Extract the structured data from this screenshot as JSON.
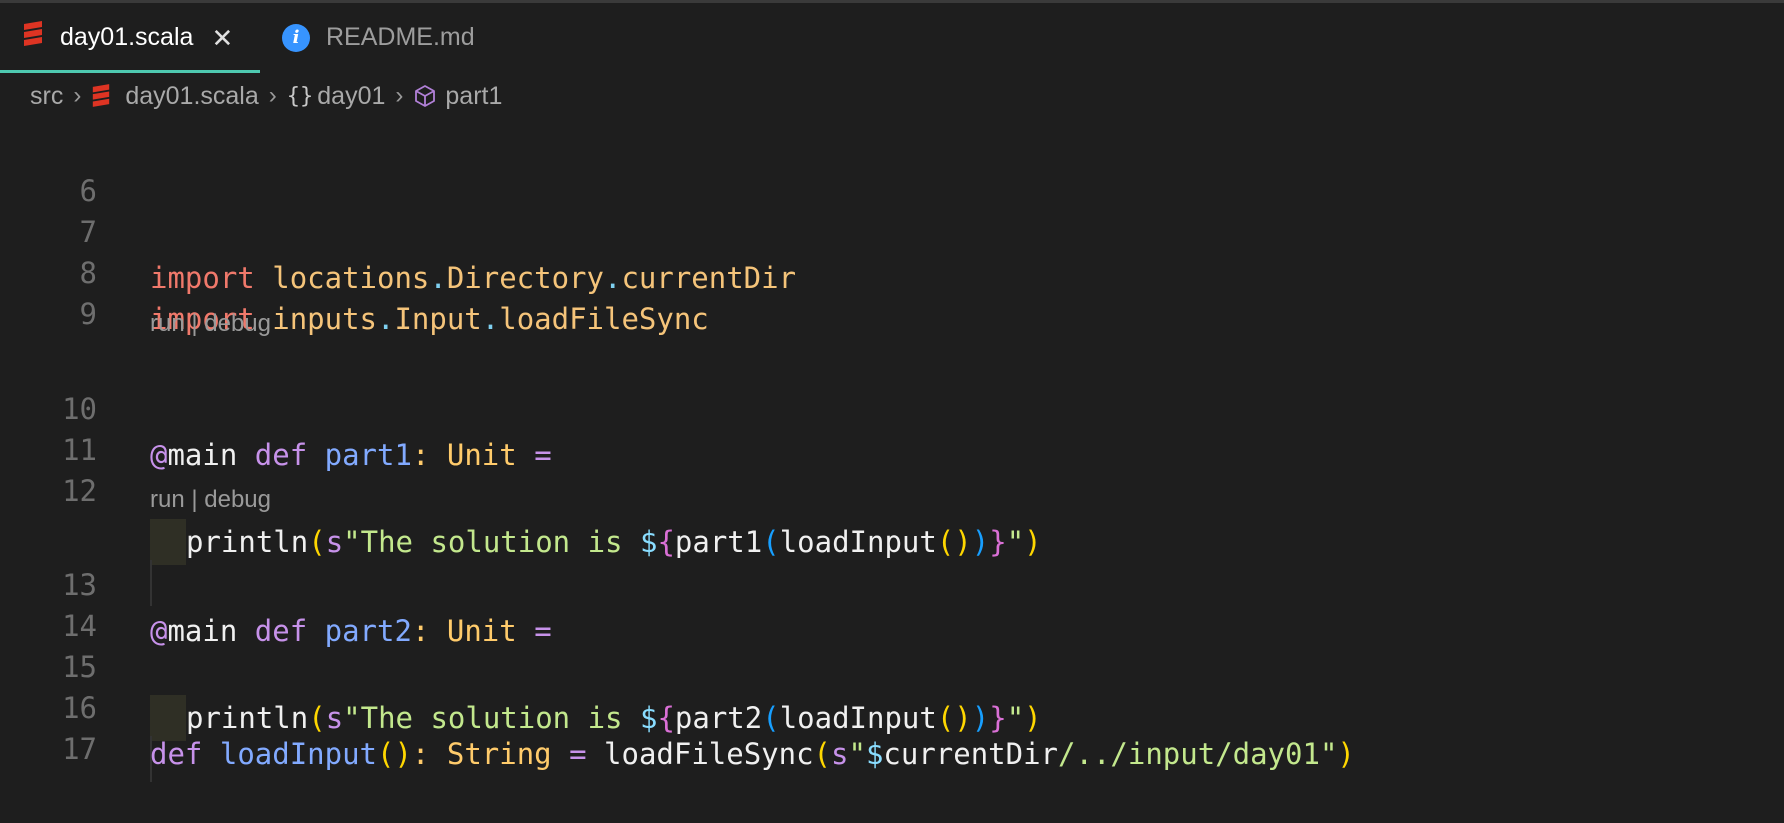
{
  "tabs": [
    {
      "label": "day01.scala",
      "icon": "scala-icon",
      "active": true
    },
    {
      "label": "README.md",
      "icon": "info-icon",
      "active": false
    }
  ],
  "breadcrumb": {
    "folder": "src",
    "file": "day01.scala",
    "object_braces": "{}",
    "object": "day01",
    "method": "part1"
  },
  "code_lens": {
    "run": "run",
    "sep": "|",
    "debug": "debug"
  },
  "lines": [
    {
      "n": "6"
    },
    {
      "n": "7",
      "imp": "import",
      "a": "locations",
      "d1": ".",
      "b": "Directory",
      "d2": ".",
      "c": "currentDir"
    },
    {
      "n": "8",
      "imp": "import",
      "a": "inputs",
      "d1": ".",
      "b": "Input",
      "d2": ".",
      "c": "loadFileSync"
    },
    {
      "n": "9"
    },
    {
      "n": "10",
      "at": "@",
      "ann": "main",
      "kw": "def",
      "name": "part1",
      "colon": ":",
      "type": "Unit",
      "eq": "="
    },
    {
      "n": "11",
      "call": "println",
      "p1": "(",
      "s": "s",
      "q1": "\"",
      "text": "The solution is ",
      "dollar": "$",
      "brace_open": "{",
      "fn": "part1",
      "p2": "(",
      "fn2": "loadInput",
      "p3": "()",
      "p4": ")",
      "brace_close": "}",
      "q2": "\"",
      "p5": ")"
    },
    {
      "n": "12"
    },
    {
      "n": "13",
      "at": "@",
      "ann": "main",
      "kw": "def",
      "name": "part2",
      "colon": ":",
      "type": "Unit",
      "eq": "="
    },
    {
      "n": "14",
      "call": "println",
      "p1": "(",
      "s": "s",
      "q1": "\"",
      "text": "The solution is ",
      "dollar": "$",
      "brace_open": "{",
      "fn": "part2",
      "p2": "(",
      "fn2": "loadInput",
      "p3": "()",
      "p4": ")",
      "brace_close": "}",
      "q2": "\"",
      "p5": ")"
    },
    {
      "n": "15"
    },
    {
      "n": "16",
      "kw": "def",
      "name": "loadInput",
      "parens": "()",
      "colon": ":",
      "type": "String",
      "eq": "=",
      "call": "loadFileSync",
      "p1": "(",
      "s": "s",
      "q1": "\"",
      "dollar": "$",
      "var": "currentDir",
      "path": "/../input/day01",
      "q2": "\"",
      "p2": ")"
    },
    {
      "n": "17"
    }
  ],
  "colors": {
    "active_tab_underline": "#4ec9b0",
    "scala_icon": "#de3423",
    "info_icon": "#3794ff"
  }
}
